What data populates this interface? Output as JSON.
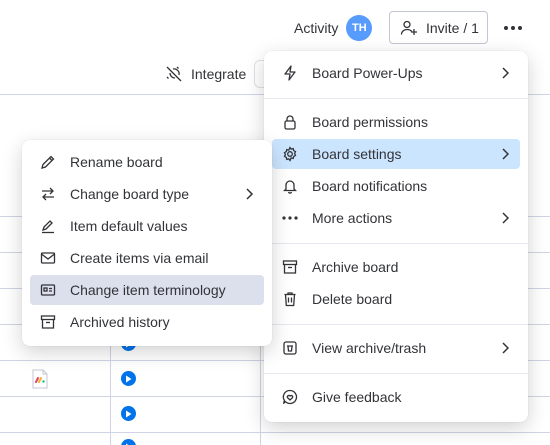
{
  "topbar": {
    "activity_label": "Activity",
    "avatar_initials": "TH",
    "invite_label": "Invite / 1",
    "integrate_label": "Integrate"
  },
  "board_menu": {
    "power_ups": "Board Power-Ups",
    "permissions": "Board permissions",
    "settings": "Board settings",
    "notifications": "Board notifications",
    "more_actions": "More actions",
    "archive": "Archive board",
    "delete": "Delete board",
    "view_archive": "View archive/trash",
    "feedback": "Give feedback"
  },
  "settings_submenu": {
    "rename": "Rename board",
    "change_type": "Change board type",
    "default_values": "Item default values",
    "create_via_email": "Create items via email",
    "terminology": "Change item terminology",
    "archived_history": "Archived history"
  },
  "colors": {
    "accent": "#0073ea",
    "avatar": "#579bfc",
    "highlight": "#cce5ff",
    "submenu_highlight": "#dcdfec"
  }
}
